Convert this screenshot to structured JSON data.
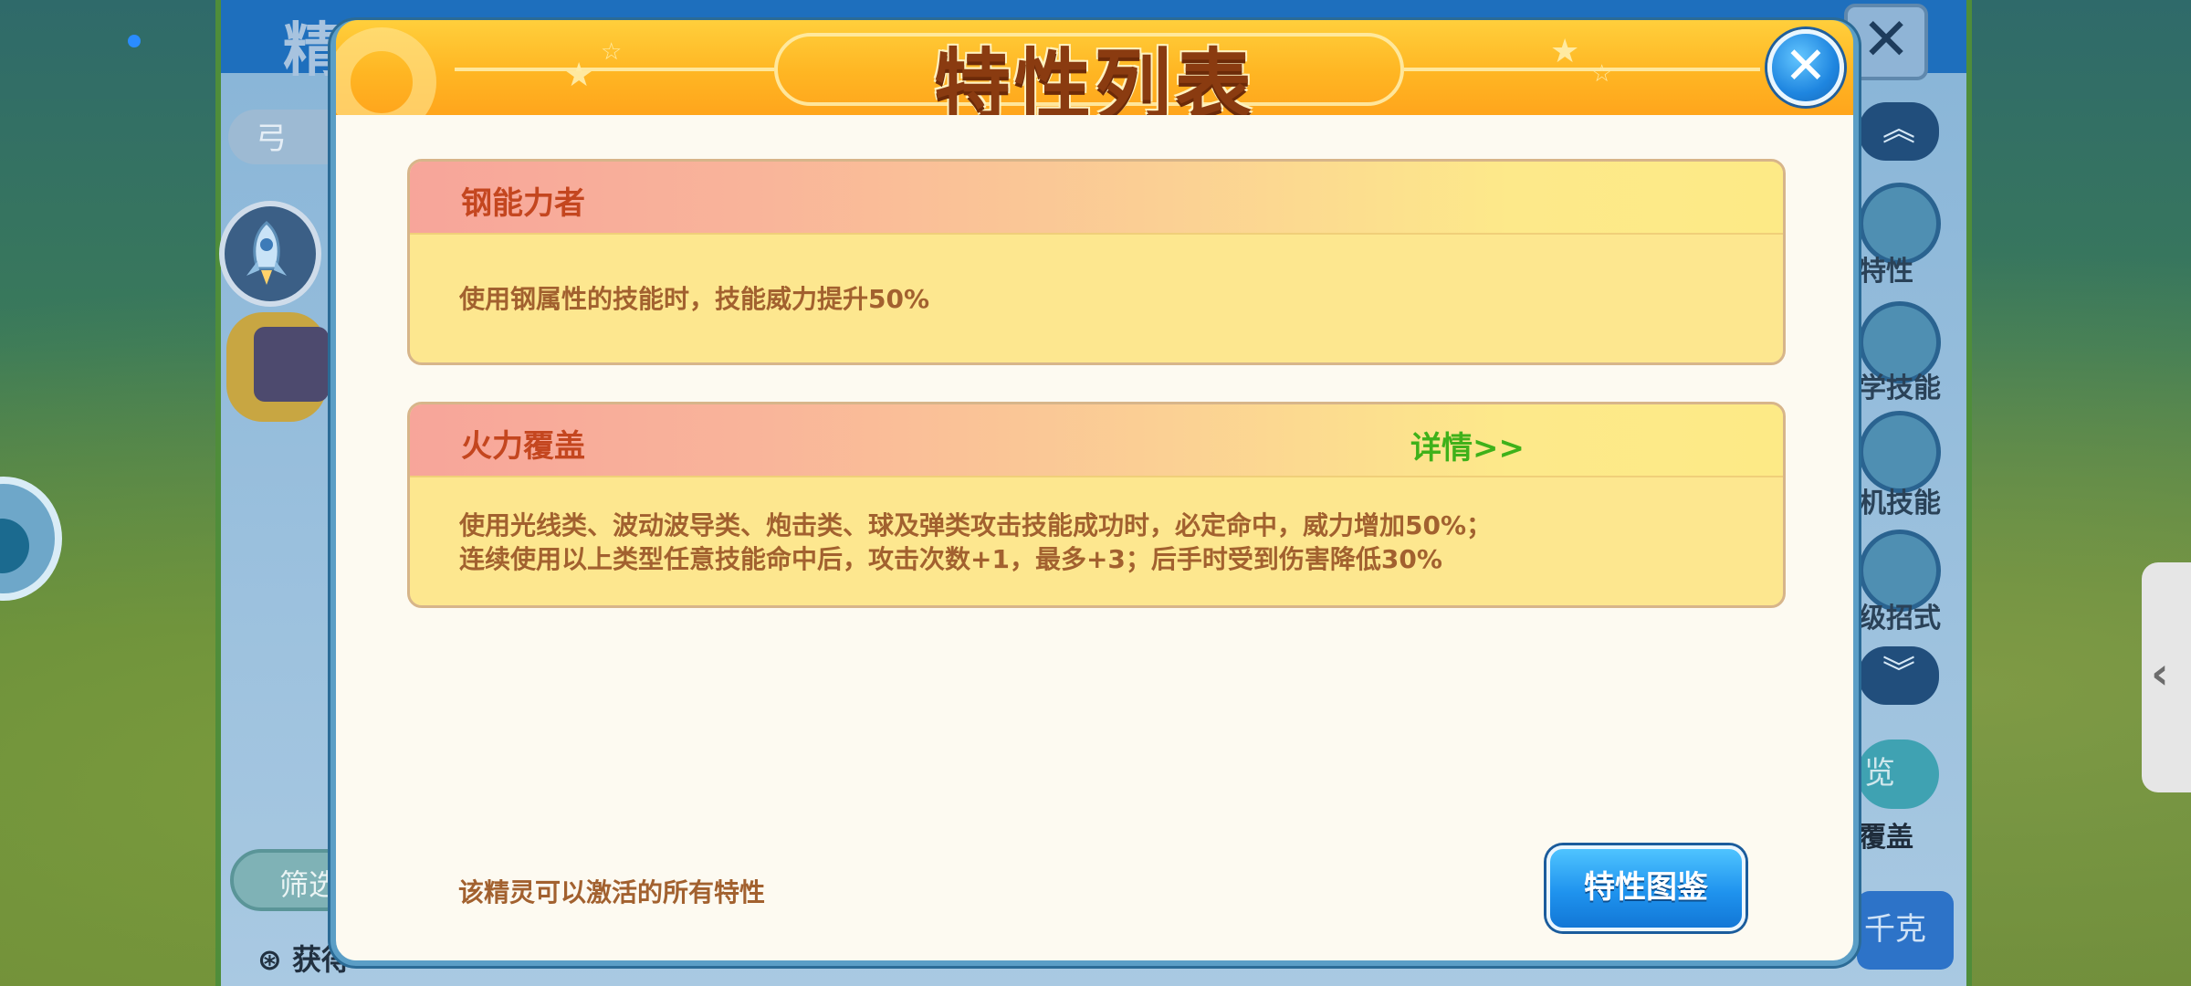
{
  "dialog": {
    "title": "特性列表",
    "close_icon": "close-icon",
    "traits": [
      {
        "name": "钢能力者",
        "detail_label": "",
        "lines": [
          "使用钢属性的技能时，技能威力提升50%"
        ]
      },
      {
        "name": "火力覆盖",
        "detail_label": "详情>>",
        "lines": [
          "使用光线类、波动波导类、炮击类、球及弹类攻击技能成功时，必定命中，威力增加50%；",
          "连续使用以上类型任意技能命中后，攻击次数+1，最多+3；后手时受到伤害降低30%"
        ]
      }
    ],
    "footer_text": "该精灵可以激活的所有特性",
    "codex_button": "特性图鉴"
  },
  "background": {
    "panel_title": "精灵图鉴",
    "search_glyph": "弓",
    "filter_label": "筛选",
    "obtain_label": "获得",
    "right_menu": [
      {
        "label": "特性",
        "icon": "trait-icon"
      },
      {
        "label": "学技能",
        "icon": "learn-skill-icon"
      },
      {
        "label": "机技能",
        "icon": "machine-skill-icon"
      },
      {
        "label": "级招式",
        "icon": "move-icon"
      }
    ],
    "overview_label": "览",
    "cover_label": "覆盖",
    "blue_button_label": "千克"
  },
  "colors": {
    "dialog_border": "#5b9ec6",
    "header_orange": "#ffb623",
    "title_brown": "#8a3b10",
    "trait_name": "#c4461f",
    "detail_green": "#3fb11a",
    "body_text": "#a2612f",
    "button_blue": "#1f93ee"
  }
}
